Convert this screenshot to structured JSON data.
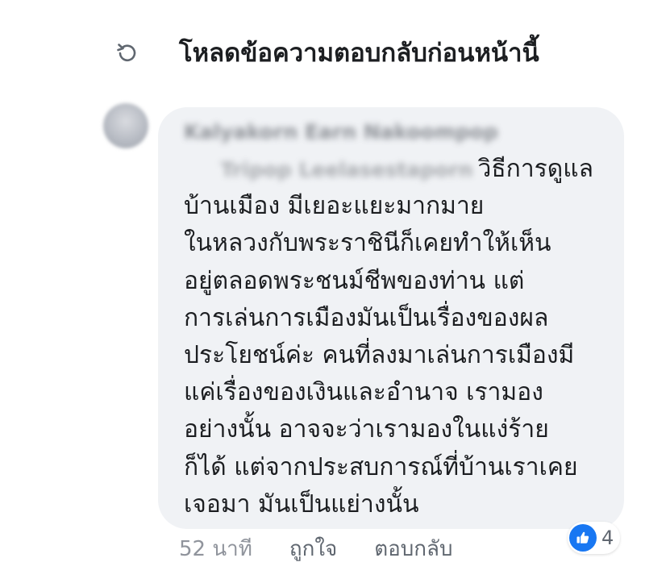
{
  "load_previous": {
    "label": "โหลดข้อความตอบกลับก่อนหน้านี้",
    "icon": "refresh-icon"
  },
  "comment": {
    "author_name": "Kalyakorn Earn Nakoompop",
    "mention": "Tripop Leelasestaporn",
    "first_line_after_mention": "วิธีการดูแล",
    "lines": [
      "บ้านเมือง มีเยอะแยะมากมาย",
      "ในหลวงกับพระราชินีก็เคยทำให้เห็น",
      "อยู่ตลอดพระชนม์ชีพของท่าน  แต่",
      "การเล่นการเมืองมันเป็นเรื่องของผล",
      "ประโยชน์ค่ะ คนที่ลงมาเล่นการเมืองมี",
      "แค่เรื่องของเงินและอำนาจ เรามอง",
      "อย่างนั้น อาจจะว่าเรามองในแง่ร้าย",
      "ก็ได้ แต่จากประสบการณ์ที่บ้านเราเคย",
      "เจอมา มันเป็นแย่างนั้น"
    ]
  },
  "actions": {
    "time": "52 นาที",
    "like": "ถูกใจ",
    "reply": "ตอบกลับ"
  },
  "reactions": {
    "icon": "thumbs-up-icon",
    "count": "4",
    "color": "#1877f2"
  }
}
